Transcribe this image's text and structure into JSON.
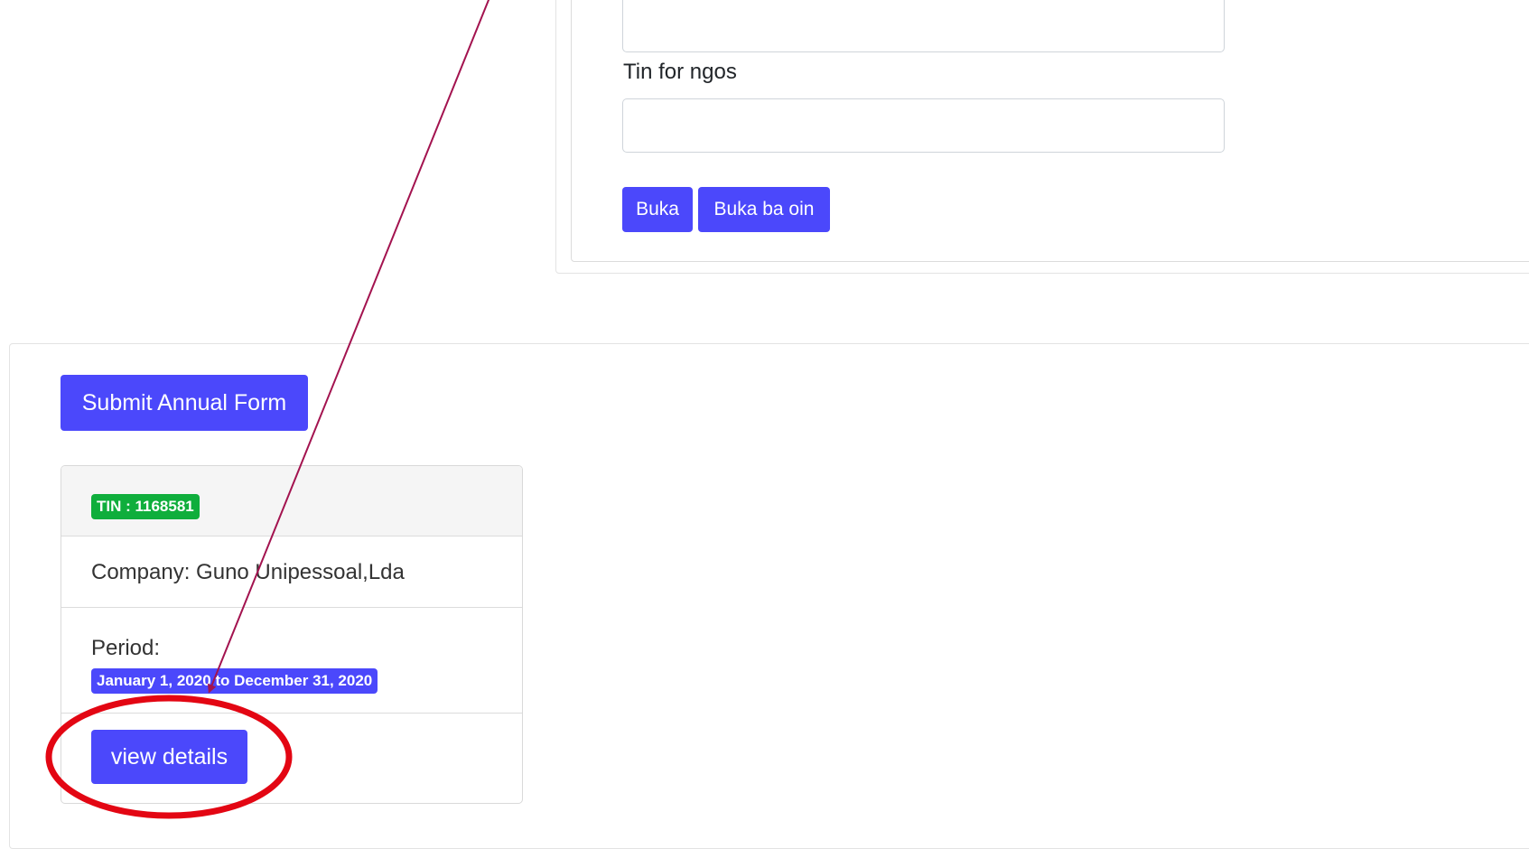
{
  "search_form": {
    "tin_ngos_label": "Tin for ngos",
    "top_input_value": "",
    "tin_input_value": "",
    "search_button": "Buka",
    "search_again_button": "Buka ba oin"
  },
  "annual_form": {
    "submit_button": "Submit Annual Form",
    "card": {
      "tin_badge": "TIN : 1168581",
      "company": "Company: Guno Unipessoal,Lda",
      "period_label": "Period:",
      "period_badge": "January 1, 2020 to December 31, 2020",
      "view_details_button": "view details"
    }
  },
  "colors": {
    "primary": "#4b48fb",
    "success": "#0fae3c",
    "annotation_arrow": "#a3134f",
    "annotation_circle": "#e30613"
  }
}
